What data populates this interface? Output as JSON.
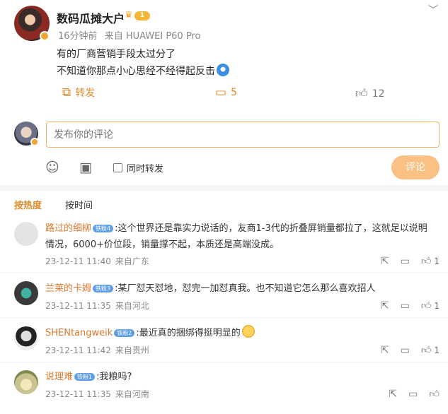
{
  "post": {
    "username": "数码瓜摊大户",
    "level": "1",
    "time": "16分钟前",
    "source": "来自 HUAWEI P60 Pro",
    "lines": [
      "有的厂商营销手段太过分了",
      "不知道你那点小心思经不经得起反击"
    ],
    "repost_label": "转发",
    "comment_count": "5",
    "like_count": "12"
  },
  "composer": {
    "placeholder": "发布你的评论",
    "also_repost": "同时转发",
    "submit": "评论"
  },
  "sort": {
    "hot": "按热度",
    "time": "按时间"
  },
  "comments": [
    {
      "name": "路过的细柳",
      "tag": "铁粉4",
      "text1": ":这个世界还是靠实力说话的，友商1-3代的折叠屏销量都拉了，这就足以说明",
      "text2": "情况，6000+价位段，销量撑不起，本质还是高端没成。",
      "time": "23-12-11 11:40",
      "loc": "来自广东",
      "likes": "1"
    },
    {
      "name": "兰莱的卡姆",
      "tag": "铁粉3",
      "text1": ":某厂怼天怼地，怼完一加怼真我。也不知道它怎么那么喜欢招人",
      "time": "23-12-11 11:35",
      "loc": "来自河北",
      "likes": "1"
    },
    {
      "name": "SHENtangweik",
      "tag": "铁粉2",
      "text1": ":最近真的捆绑得挺明显的",
      "time": "23-12-11 11:42",
      "loc": "来自贵州",
      "likes": "1"
    },
    {
      "name": "说理难",
      "tag": "铁粉1",
      "text1": ":我粮吗?",
      "time": "23-12-11 11:35",
      "loc": "来自河南",
      "likes": ""
    }
  ]
}
